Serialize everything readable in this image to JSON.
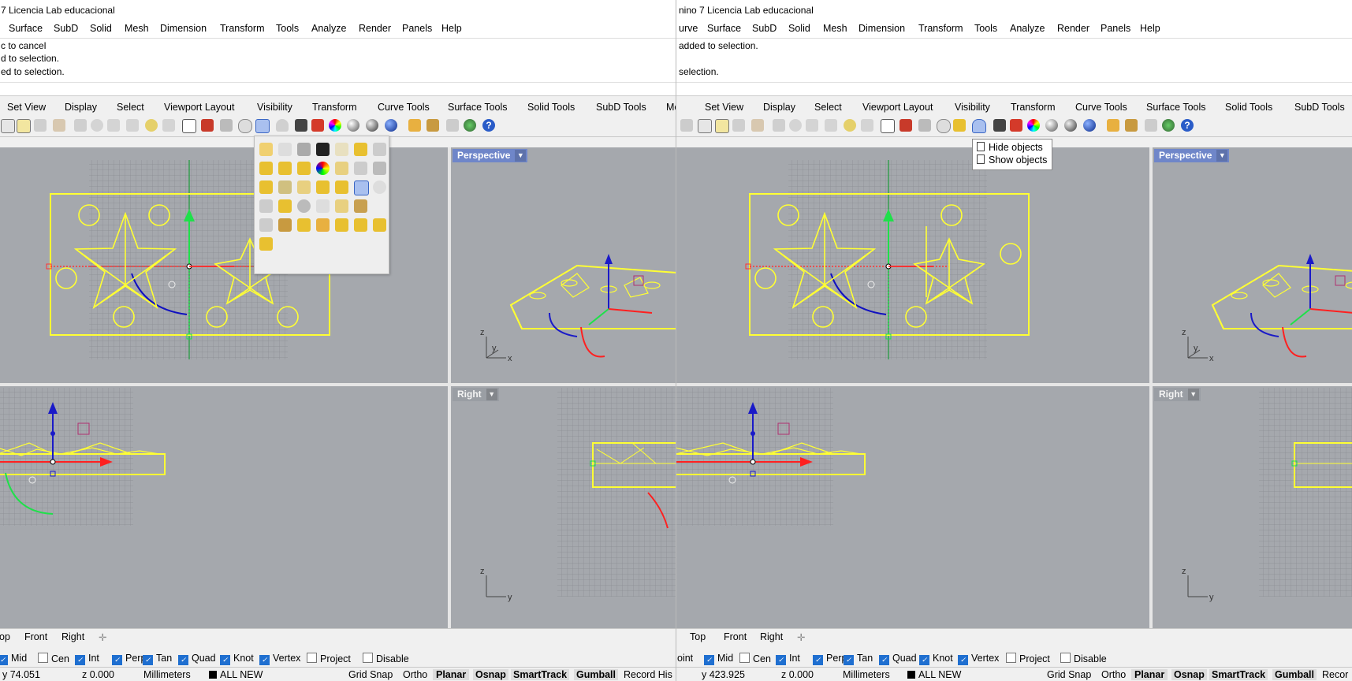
{
  "left": {
    "title": "7 Licencia Lab educacional",
    "menu": [
      "Surface",
      "SubD",
      "Solid",
      "Mesh",
      "Dimension",
      "Transform",
      "Tools",
      "Analyze",
      "Render",
      "Panels",
      "Help"
    ],
    "history": [
      "c to cancel",
      "d to selection.",
      "ed to selection."
    ],
    "tabs": [
      "Set View",
      "Display",
      "Select",
      "Viewport Layout",
      "Visibility",
      "Transform",
      "Curve Tools",
      "Surface Tools",
      "Solid Tools",
      "SubD Tools",
      "Mes"
    ],
    "viewport_tabs": [
      "op",
      "Front",
      "Right"
    ],
    "osnaps": [
      {
        "label": "Mid",
        "checked": true
      },
      {
        "label": "Cen",
        "checked": false
      },
      {
        "label": "Int",
        "checked": true
      },
      {
        "label": "Perp",
        "checked": true
      },
      {
        "label": "Tan",
        "checked": true
      },
      {
        "label": "Quad",
        "checked": true
      },
      {
        "label": "Knot",
        "checked": true
      },
      {
        "label": "Vertex",
        "checked": true
      },
      {
        "label": "Project",
        "checked": false
      },
      {
        "label": "Disable",
        "checked": false
      }
    ],
    "status": {
      "y": "y 74.051",
      "z": "z 0.000",
      "units": "Millimeters",
      "layer": "ALL NEW",
      "grid_snap": "Grid Snap",
      "ortho": "Ortho",
      "planar": "Planar",
      "osnap": "Osnap",
      "smarttrack": "SmartTrack",
      "gumball": "Gumball",
      "record": "Record His"
    }
  },
  "right": {
    "title": "nino 7 Licencia Lab educacional",
    "menu": [
      "urve",
      "Surface",
      "SubD",
      "Solid",
      "Mesh",
      "Dimension",
      "Transform",
      "Tools",
      "Analyze",
      "Render",
      "Panels",
      "Help"
    ],
    "history": [
      "added to selection.",
      "selection."
    ],
    "tabs": [
      "Set View",
      "Display",
      "Select",
      "Viewport Layout",
      "Visibility",
      "Transform",
      "Curve Tools",
      "Surface Tools",
      "Solid Tools",
      "SubD Tools"
    ],
    "viewport_tabs": [
      "Top",
      "Front",
      "Right"
    ],
    "osnaps": [
      {
        "label": "oint",
        "checked": false
      },
      {
        "label": "Mid",
        "checked": true
      },
      {
        "label": "Cen",
        "checked": false
      },
      {
        "label": "Int",
        "checked": true
      },
      {
        "label": "Perp",
        "checked": true
      },
      {
        "label": "Tan",
        "checked": true
      },
      {
        "label": "Quad",
        "checked": true
      },
      {
        "label": "Knot",
        "checked": true
      },
      {
        "label": "Vertex",
        "checked": true
      },
      {
        "label": "Project",
        "checked": false
      },
      {
        "label": "Disable",
        "checked": false
      }
    ],
    "status": {
      "y": "y 423.925",
      "z": "z 0.000",
      "units": "Millimeters",
      "layer": "ALL NEW",
      "grid_snap": "Grid Snap",
      "ortho": "Ortho",
      "planar": "Planar",
      "osnap": "Osnap",
      "smarttrack": "SmartTrack",
      "gumball": "Gumball",
      "record": "Recor"
    }
  },
  "viewports": {
    "perspective": "Perspective",
    "right": "Right"
  },
  "tooltip": {
    "hide": "Hide objects",
    "show": "Show objects"
  },
  "axes": {
    "x": "x",
    "y": "y",
    "z": "z"
  },
  "colors": {
    "accent": "#6f86c9",
    "wire": "#ffff33",
    "viewport_bg": "#a5a8ad",
    "grid": "#8a8d92"
  }
}
